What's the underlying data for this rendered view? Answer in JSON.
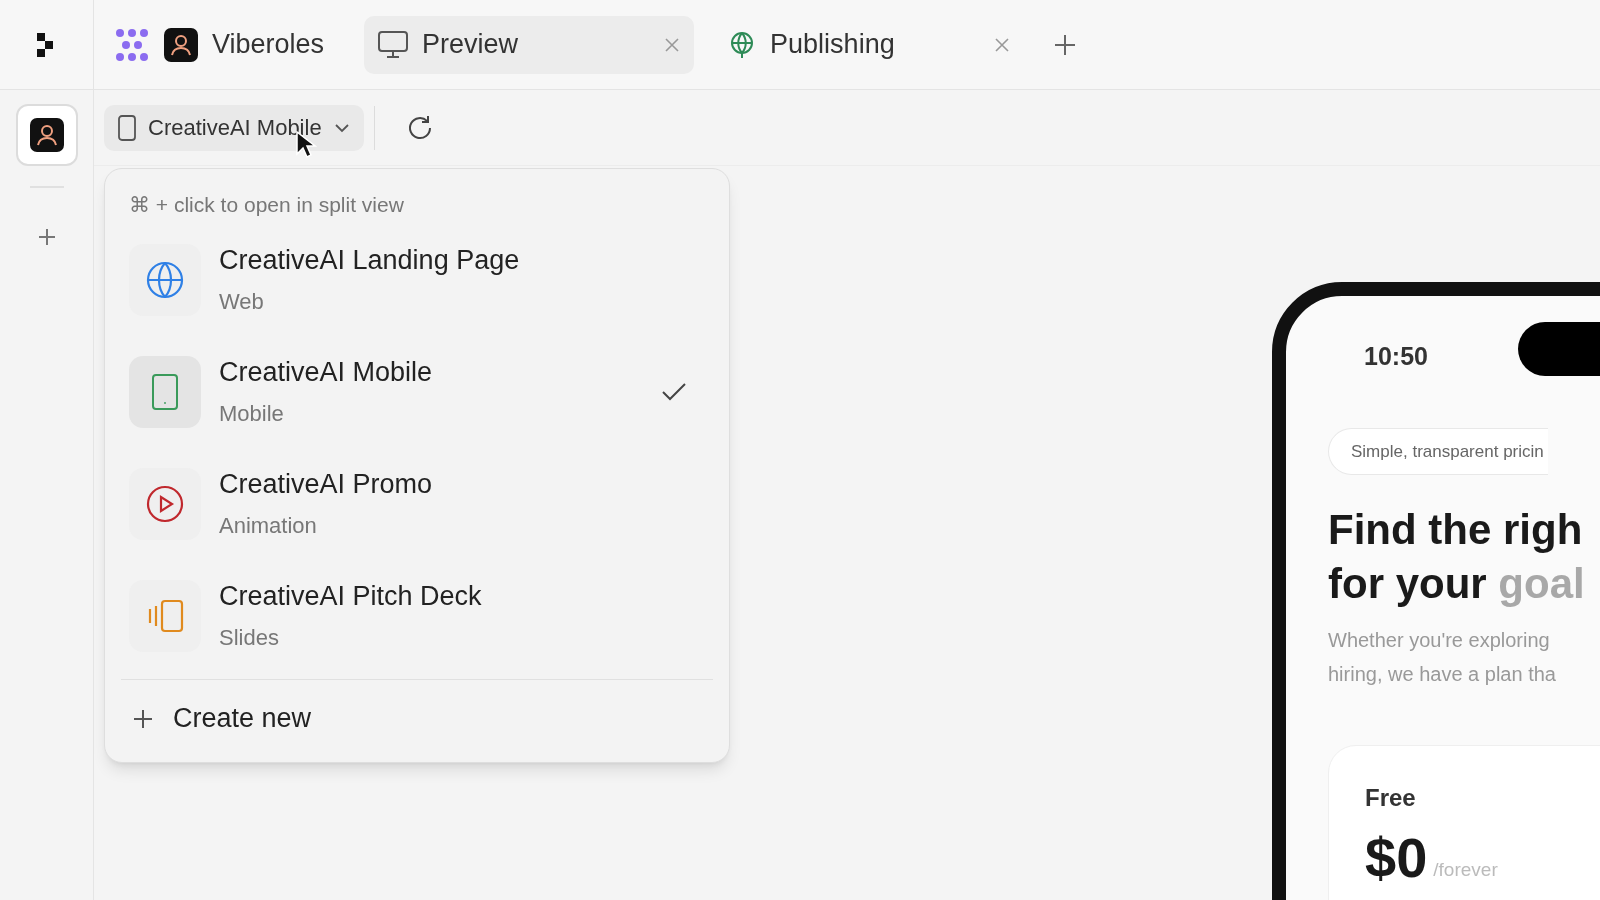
{
  "top_bar": {
    "app_name": "Viberoles",
    "tabs": [
      {
        "label": "Preview",
        "kind": "monitor",
        "selected": true
      },
      {
        "label": "Publishing",
        "kind": "globe",
        "selected": false
      }
    ]
  },
  "toolbar": {
    "device_select": "CreativeAI Mobile"
  },
  "dropdown": {
    "hint": "⌘ + click to open in split view",
    "items": [
      {
        "title": "CreativeAI Landing Page",
        "subtitle": "Web",
        "kind": "web",
        "color": "#2f80e6",
        "selected": false
      },
      {
        "title": "CreativeAI Mobile",
        "subtitle": "Mobile",
        "kind": "mobile",
        "color": "#3a9a5a",
        "selected": true
      },
      {
        "title": "CreativeAI Promo",
        "subtitle": "Animation",
        "kind": "animation",
        "color": "#c0282d",
        "selected": false
      },
      {
        "title": "CreativeAI Pitch Deck",
        "subtitle": "Slides",
        "kind": "slides",
        "color": "#e08a1e",
        "selected": false
      }
    ],
    "create_label": "Create new"
  },
  "preview": {
    "time": "10:50",
    "badge": "Simple, transparent pricin",
    "heading_line_1": "Find the righ",
    "heading_line_2": "for your **goal**",
    "subtitle_line_1": "Whether you're exploring",
    "subtitle_line_2": "hiring, we have a plan tha",
    "plan_name": "Free",
    "price": "$0",
    "period": "/forever"
  }
}
